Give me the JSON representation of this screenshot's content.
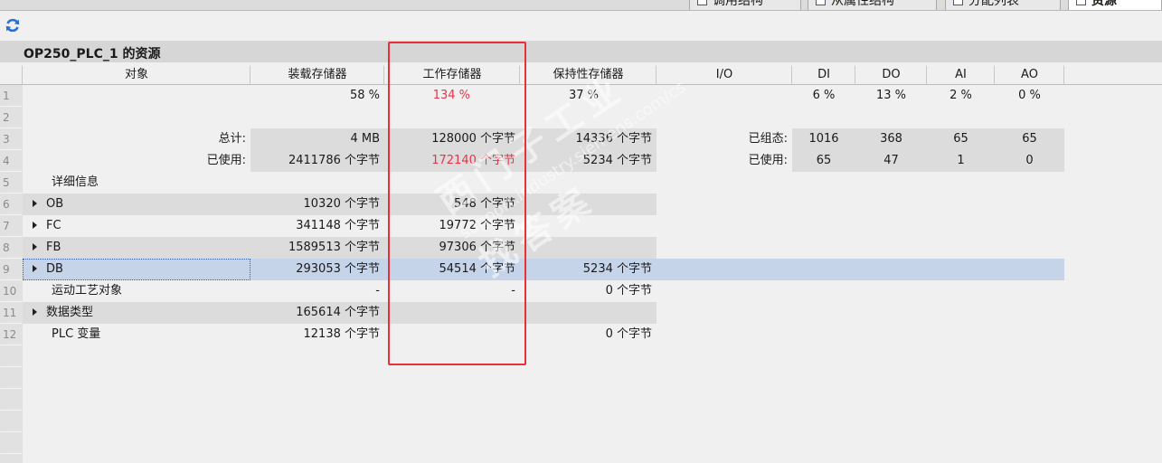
{
  "tabs": [
    {
      "label": "调用结构",
      "active": false
    },
    {
      "label": "从属性结构",
      "active": false
    },
    {
      "label": "分配列表",
      "active": false
    },
    {
      "label": "资源",
      "active": true
    }
  ],
  "toolbar": {
    "refresh_icon": "refresh-icon"
  },
  "title": "OP250_PLC_1 的资源",
  "headers": {
    "object": "对象",
    "load": "装载存储器",
    "work": "工作存储器",
    "retain": "保持性存储器",
    "io": "I/O",
    "di": "DI",
    "do": "DO",
    "ai": "AI",
    "ao": "AO"
  },
  "rows": [
    {
      "num": "1",
      "object": "",
      "load": "58 %",
      "work": "134 %",
      "retain": "37 %",
      "io": "",
      "di": "6 %",
      "do": "13 %",
      "ai": "2 %",
      "ao": "0 %"
    },
    {
      "num": "2",
      "object": "",
      "load": "",
      "work": "",
      "retain": "",
      "io": "",
      "di": "",
      "do": "",
      "ai": "",
      "ao": ""
    },
    {
      "num": "3",
      "object": "总计:",
      "load": "4 MB",
      "work": "128000 个字节",
      "retain": "14336 个字节",
      "io": "已组态:",
      "di": "1016",
      "do": "368",
      "ai": "65",
      "ao": "65"
    },
    {
      "num": "4",
      "object": "已使用:",
      "load": "2411786 个字节",
      "work": "172140 个字节",
      "retain": "5234 个字节",
      "io": "已使用:",
      "di": "65",
      "do": "47",
      "ai": "1",
      "ao": "0"
    },
    {
      "num": "5",
      "object": "详细信息",
      "load": "",
      "work": "",
      "retain": "",
      "io": "",
      "di": "",
      "do": "",
      "ai": "",
      "ao": ""
    },
    {
      "num": "6",
      "object": "OB",
      "load": "10320 个字节",
      "work": "548 个字节",
      "retain": "",
      "io": "",
      "di": "",
      "do": "",
      "ai": "",
      "ao": ""
    },
    {
      "num": "7",
      "object": "FC",
      "load": "341148 个字节",
      "work": "19772 个字节",
      "retain": "",
      "io": "",
      "di": "",
      "do": "",
      "ai": "",
      "ao": ""
    },
    {
      "num": "8",
      "object": "FB",
      "load": "1589513 个字节",
      "work": "97306 个字节",
      "retain": "",
      "io": "",
      "di": "",
      "do": "",
      "ai": "",
      "ao": ""
    },
    {
      "num": "9",
      "object": "DB",
      "load": "293053 个字节",
      "work": "54514 个字节",
      "retain": "5234 个字节",
      "io": "",
      "di": "",
      "do": "",
      "ai": "",
      "ao": ""
    },
    {
      "num": "10",
      "object": "运动工艺对象",
      "load": "-",
      "work": "-",
      "retain": "0 个字节",
      "io": "",
      "di": "",
      "do": "",
      "ai": "",
      "ao": ""
    },
    {
      "num": "11",
      "object": "数据类型",
      "load": "165614 个字节",
      "work": "",
      "retain": "",
      "io": "",
      "di": "",
      "do": "",
      "ai": "",
      "ao": ""
    },
    {
      "num": "12",
      "object": "PLC 变量",
      "load": "12138 个字节",
      "work": "",
      "retain": "0 个字节",
      "io": "",
      "di": "",
      "do": "",
      "ai": "",
      "ao": ""
    }
  ],
  "watermark": {
    "line1": "西门子工业",
    "line2": "support.industry.siemens.com/cs",
    "line3": "找答案"
  },
  "colors": {
    "highlight": "#e8303a",
    "over_limit_text": "#e8344a",
    "selected_row": "#c6d4ea"
  }
}
